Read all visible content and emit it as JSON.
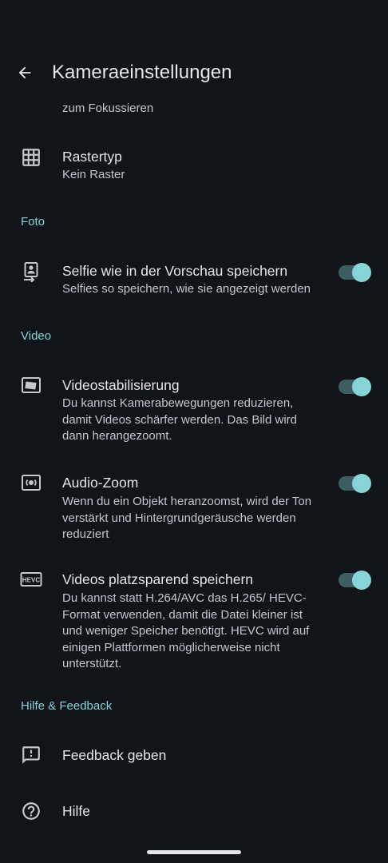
{
  "header": {
    "title": "Kameraeinstellungen"
  },
  "rows": {
    "focus_partial": {
      "subtitle": "zum Fokussieren"
    },
    "grid": {
      "title": "Rastertyp",
      "subtitle": "Kein Raster"
    }
  },
  "sections": {
    "photo": {
      "label": "Foto",
      "selfie": {
        "title": "Selfie wie in der Vorschau speichern",
        "subtitle": "Selfies so speichern, wie sie angezeigt werden",
        "enabled": true
      }
    },
    "video": {
      "label": "Video",
      "stabilization": {
        "title": "Videostabilisierung",
        "subtitle": "Du kannst Kamerabewegungen reduzieren, damit Videos schärfer werden. Das Bild wird dann herangezoomt.",
        "enabled": true
      },
      "audio_zoom": {
        "title": "Audio-Zoom",
        "subtitle": "Wenn du ein Objekt heranzoomst, wird der Ton verstärkt und Hintergrundgeräusche werden reduziert",
        "enabled": true
      },
      "hevc": {
        "title": "Videos platzsparend speichern",
        "subtitle": "Du kannst statt H.264/AVC das H.265/ HEVC-Format verwenden, damit die Datei kleiner ist und weniger Speicher benötigt. HEVC wird auf einigen Plattformen möglicherweise nicht unterstützt.",
        "enabled": true,
        "icon_text": "HEVC"
      }
    },
    "help": {
      "label": "Hilfe & Feedback",
      "feedback": {
        "title": "Feedback geben"
      },
      "help": {
        "title": "Hilfe"
      }
    }
  },
  "icons": {
    "back": "arrow-back-icon",
    "grid": "grid-icon",
    "selfie": "selfie-portrait-icon",
    "stabilization": "video-stabilization-icon",
    "audio_zoom": "audio-zoom-icon",
    "hevc": "hevc-icon",
    "feedback": "feedback-icon",
    "help": "help-circle-icon"
  },
  "colors": {
    "background": "#111418",
    "accent": "#86d3d8",
    "toggle_track": "#3c5e61",
    "primary_text": "#e6e6e9",
    "secondary_text": "#c3c6cc",
    "icon": "#c5c7cc"
  }
}
